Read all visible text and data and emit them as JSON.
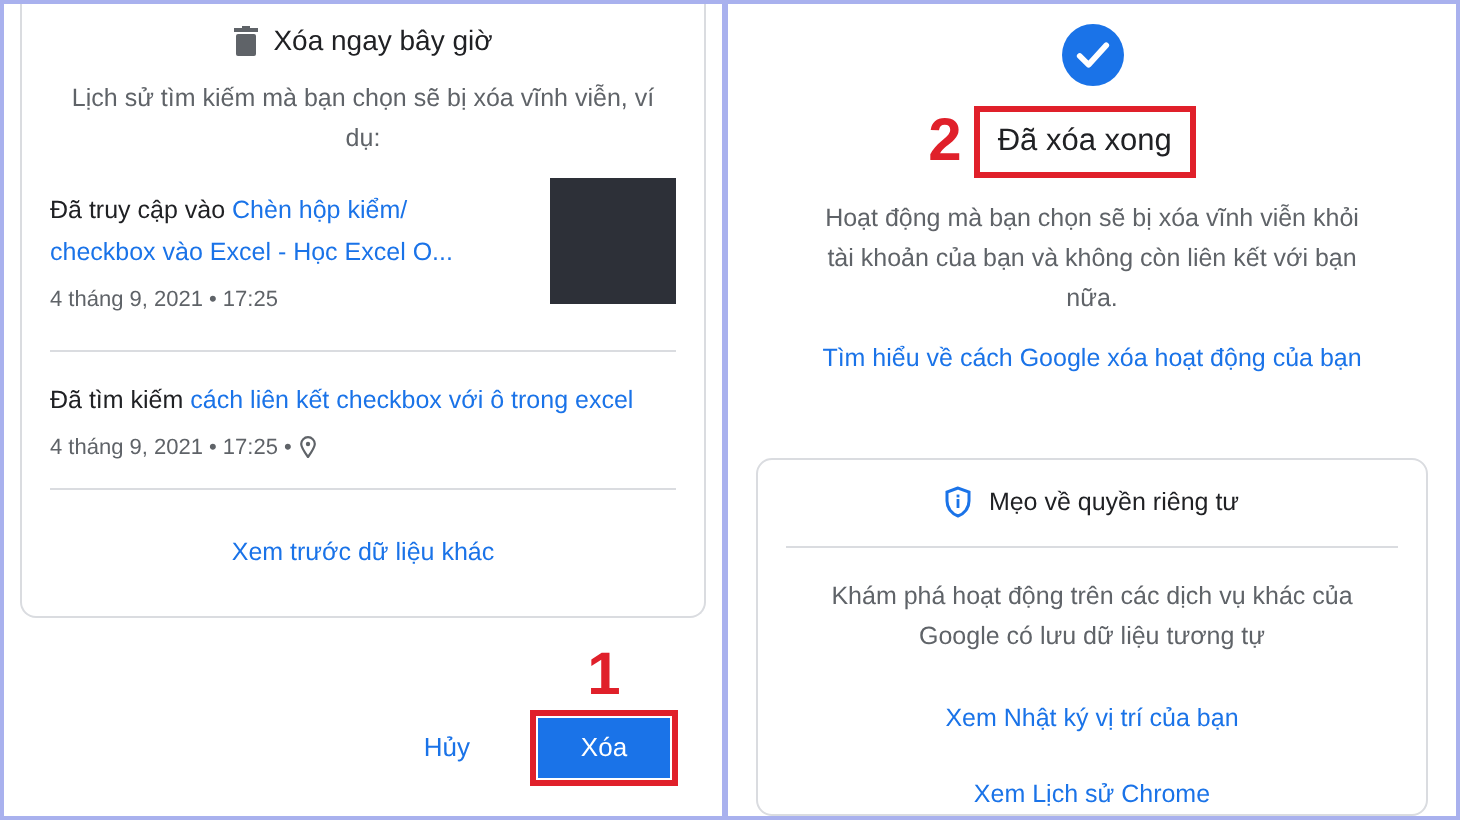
{
  "left": {
    "title": "Xóa ngay bây giờ",
    "description": "Lịch sử tìm kiếm mà bạn chọn sẽ bị xóa vĩnh viễn, ví dụ:",
    "items": [
      {
        "prefix": "Đã truy cập vào",
        "link": "Chèn hộp kiểm/ checkbox vào Excel - Học Excel O...",
        "meta": "4 tháng 9, 2021 • 17:25",
        "thumbnail": true,
        "location": false
      },
      {
        "prefix": "Đã tìm kiếm",
        "link": "cách liên kết checkbox với ô trong excel",
        "meta": "4 tháng 9, 2021 • 17:25 •",
        "thumbnail": false,
        "location": true
      }
    ],
    "more_link": "Xem trước dữ liệu khác",
    "buttons": [
      {
        "label": "Hủy",
        "kind": "text"
      },
      {
        "label": "Xóa",
        "kind": "filled",
        "annotation": "1"
      }
    ]
  },
  "right": {
    "title": "Đã xóa xong",
    "annotation": "2",
    "description": "Hoạt động mà bạn chọn sẽ bị xóa vĩnh viễn khỏi tài khoản của bạn và không còn liên kết với bạn nữa.",
    "learn_link": "Tìm hiểu về cách Google xóa hoạt động của bạn",
    "tips": {
      "title": "Mẹo về quyền riêng tư",
      "text": "Khám phá hoạt động trên các dịch vụ khác của Google có lưu dữ liệu tương tự",
      "links": [
        "Xem Nhật ký vị trí của bạn",
        "Xem Lịch sử Chrome"
      ]
    }
  }
}
